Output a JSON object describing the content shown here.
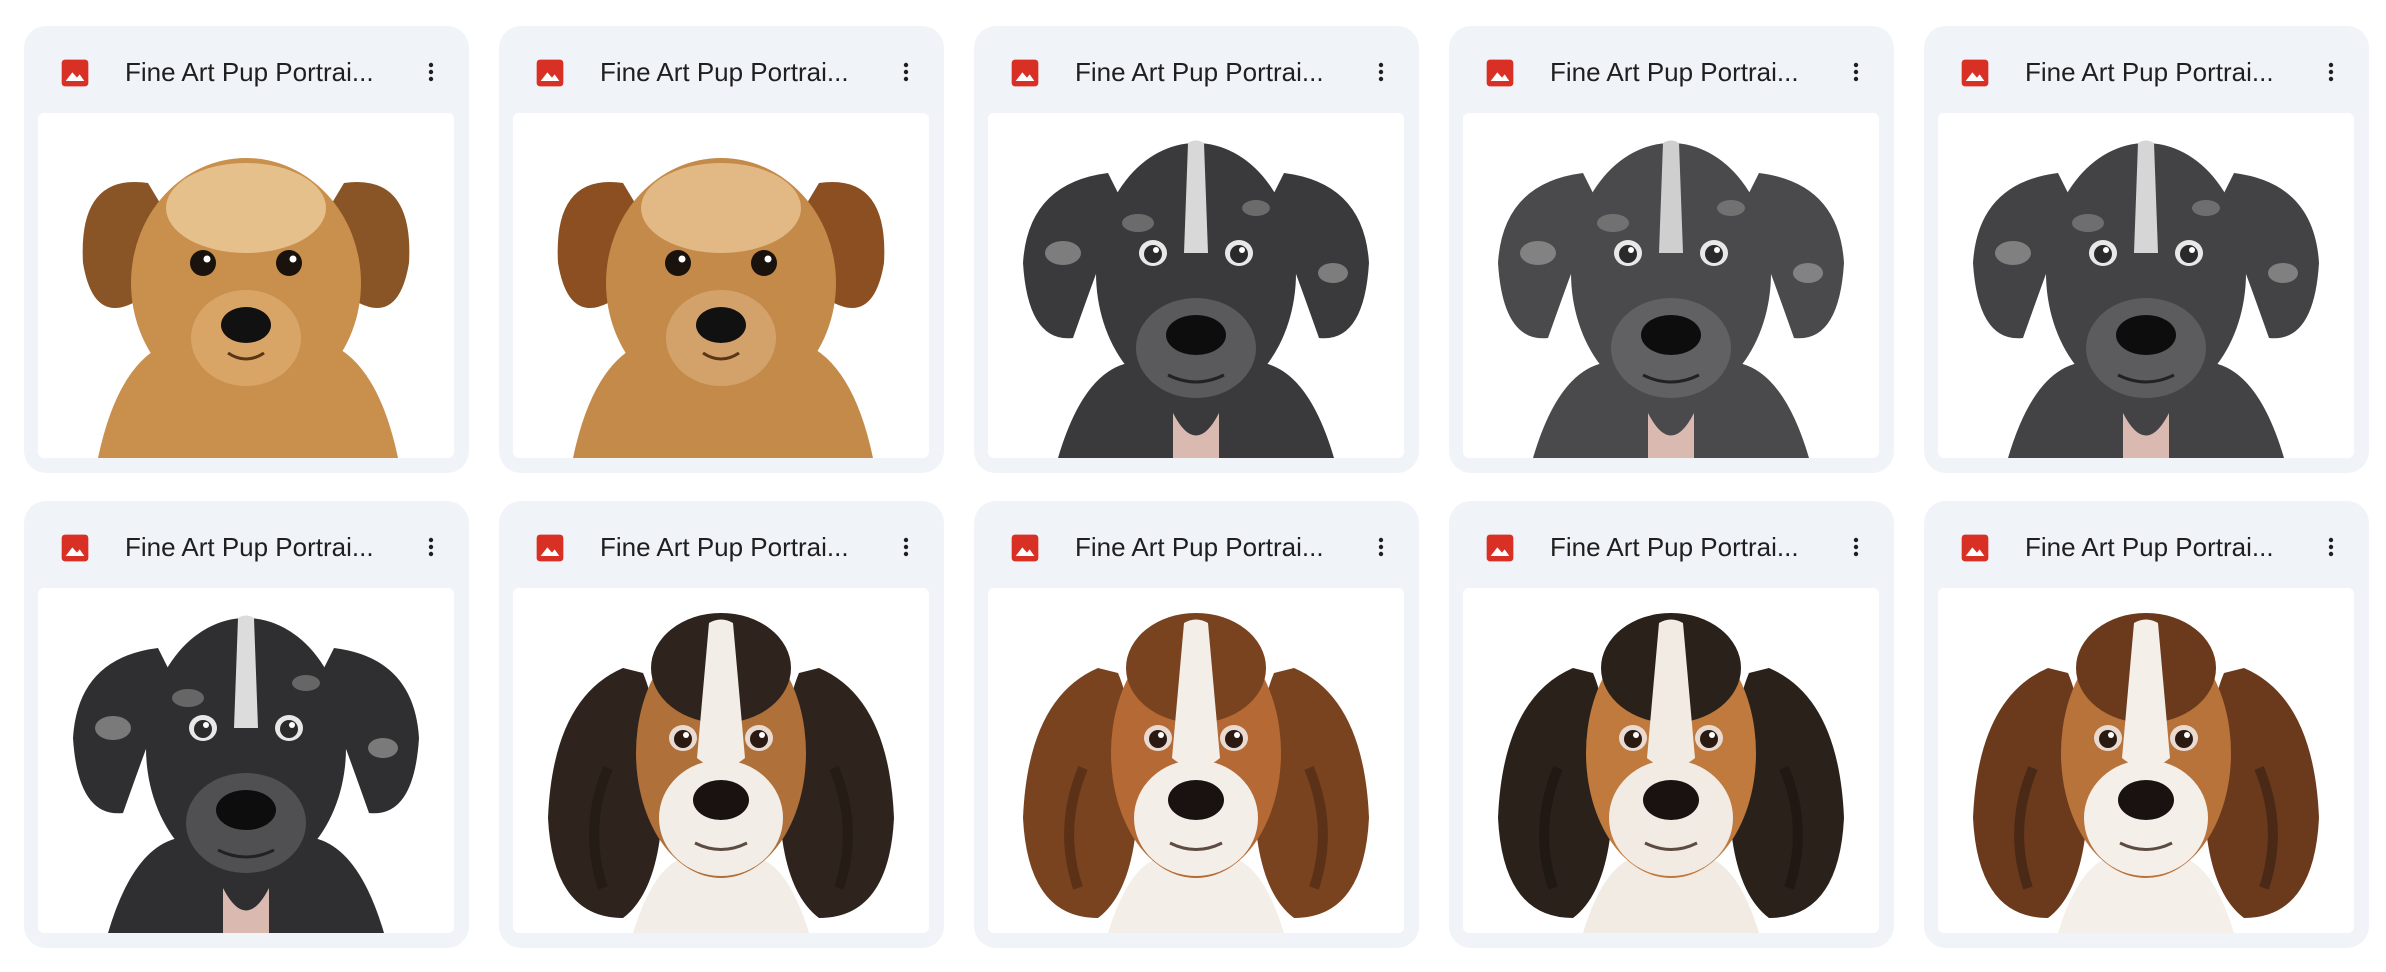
{
  "colors": {
    "card_bg": "#f0f4f9",
    "image_icon": "#d93025",
    "text": "#1f1f1f"
  },
  "files": [
    {
      "name": "Fine Art Pup Portrai...",
      "icon": "image-file-icon",
      "breed": "golden-terrier",
      "palette": {
        "fur": "#c98f4c",
        "dark": "#8a5526",
        "light": "#e6c08a",
        "muzzle": "#d9a566"
      }
    },
    {
      "name": "Fine Art Pup Portrai...",
      "icon": "image-file-icon",
      "breed": "golden-terrier",
      "palette": {
        "fur": "#c48a4a",
        "dark": "#8b4f22",
        "light": "#e2b985",
        "muzzle": "#d3a26a"
      }
    },
    {
      "name": "Fine Art Pup Portrai...",
      "icon": "image-file-icon",
      "breed": "merle-dane",
      "palette": {
        "fur": "#3a3a3d",
        "dark": "#1c1c1e",
        "light": "#d8d8d8",
        "muzzle": "#5a5a5c"
      }
    },
    {
      "name": "Fine Art Pup Portrai...",
      "icon": "image-file-icon",
      "breed": "merle-dane",
      "palette": {
        "fur": "#4a4a4c",
        "dark": "#222224",
        "light": "#cfcfcf",
        "muzzle": "#616163"
      }
    },
    {
      "name": "Fine Art Pup Portrai...",
      "icon": "image-file-icon",
      "breed": "merle-dane",
      "palette": {
        "fur": "#434346",
        "dark": "#1f1f21",
        "light": "#d6d6d6",
        "muzzle": "#5c5c5e"
      }
    },
    {
      "name": "Fine Art Pup Portrai...",
      "icon": "image-file-icon",
      "breed": "merle-dane",
      "palette": {
        "fur": "#2f2f31",
        "dark": "#151517",
        "light": "#dcdcdc",
        "muzzle": "#505052"
      }
    },
    {
      "name": "Fine Art Pup Portrai...",
      "icon": "image-file-icon",
      "breed": "basset",
      "palette": {
        "fur": "#2e241d",
        "dark": "#1a130e",
        "light": "#f2ede6",
        "muzzle": "#b0703a"
      }
    },
    {
      "name": "Fine Art Pup Portrai...",
      "icon": "image-file-icon",
      "breed": "basset",
      "palette": {
        "fur": "#7a4320",
        "dark": "#3b1f0e",
        "light": "#f3eee8",
        "muzzle": "#b56a35"
      }
    },
    {
      "name": "Fine Art Pup Portrai...",
      "icon": "image-file-icon",
      "breed": "basset",
      "palette": {
        "fur": "#2a211b",
        "dark": "#15100c",
        "light": "#f1ebe3",
        "muzzle": "#c07a3d"
      }
    },
    {
      "name": "Fine Art Pup Portrai...",
      "icon": "image-file-icon",
      "breed": "basset",
      "palette": {
        "fur": "#6b3a1c",
        "dark": "#2a1a10",
        "light": "#f4efe9",
        "muzzle": "#b8733b"
      }
    }
  ]
}
